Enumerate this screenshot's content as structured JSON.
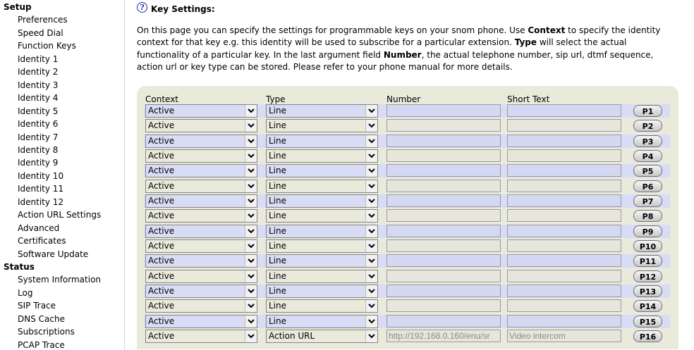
{
  "sidebar": {
    "setup_heading": "Setup",
    "setup_items": [
      "Preferences",
      "Speed Dial",
      "Function Keys",
      "Identity 1",
      "Identity 2",
      "Identity 3",
      "Identity 4",
      "Identity 5",
      "Identity 6",
      "Identity 7",
      "Identity 8",
      "Identity 9",
      "Identity 10",
      "Identity 11",
      "Identity 12",
      "Action URL Settings",
      "Advanced",
      "Certificates",
      "Software Update"
    ],
    "status_heading": "Status",
    "status_items": [
      "System Information",
      "Log",
      "SIP Trace",
      "DNS Cache",
      "Subscriptions",
      "PCAP Trace"
    ]
  },
  "page": {
    "title": "Key Settings:",
    "help_icon": "help-icon",
    "intro": [
      {
        "t": "On this page you can specify the settings for programmable keys on your snom phone. Use ",
        "b": false
      },
      {
        "t": "Context",
        "b": true
      },
      {
        "t": " to specify the identity context for that key e.g. this identity will be used to subscribe for a particular extension. ",
        "b": false
      },
      {
        "t": "Type",
        "b": true
      },
      {
        "t": " will select the actual functionality of a particular key. In the last argument field ",
        "b": false
      },
      {
        "t": "Number",
        "b": true
      },
      {
        "t": ", the actual telephone number, sip url, dtmf sequence, action url or key type can be stored. Please refer to your phone manual for more details.",
        "b": false
      }
    ]
  },
  "table": {
    "headers": {
      "context": "Context",
      "type": "Type",
      "number": "Number",
      "short_text": "Short Text"
    },
    "rows": [
      {
        "context": "Active",
        "type": "Line",
        "number": "",
        "short_text": "",
        "key": "P1"
      },
      {
        "context": "Active",
        "type": "Line",
        "number": "",
        "short_text": "",
        "key": "P2"
      },
      {
        "context": "Active",
        "type": "Line",
        "number": "",
        "short_text": "",
        "key": "P3"
      },
      {
        "context": "Active",
        "type": "Line",
        "number": "",
        "short_text": "",
        "key": "P4"
      },
      {
        "context": "Active",
        "type": "Line",
        "number": "",
        "short_text": "",
        "key": "P5"
      },
      {
        "context": "Active",
        "type": "Line",
        "number": "",
        "short_text": "",
        "key": "P6"
      },
      {
        "context": "Active",
        "type": "Line",
        "number": "",
        "short_text": "",
        "key": "P7"
      },
      {
        "context": "Active",
        "type": "Line",
        "number": "",
        "short_text": "",
        "key": "P8"
      },
      {
        "context": "Active",
        "type": "Line",
        "number": "",
        "short_text": "",
        "key": "P9"
      },
      {
        "context": "Active",
        "type": "Line",
        "number": "",
        "short_text": "",
        "key": "P10"
      },
      {
        "context": "Active",
        "type": "Line",
        "number": "",
        "short_text": "",
        "key": "P11"
      },
      {
        "context": "Active",
        "type": "Line",
        "number": "",
        "short_text": "",
        "key": "P12"
      },
      {
        "context": "Active",
        "type": "Line",
        "number": "",
        "short_text": "",
        "key": "P13"
      },
      {
        "context": "Active",
        "type": "Line",
        "number": "",
        "short_text": "",
        "key": "P14"
      },
      {
        "context": "Active",
        "type": "Line",
        "number": "",
        "short_text": "",
        "key": "P15"
      },
      {
        "context": "Active",
        "type": "Action URL",
        "number": "http://192.168.0.160/enu/sr",
        "short_text": "Video intercom",
        "key": "P16"
      }
    ]
  },
  "colors": {
    "panel_bg": "#eaeadc",
    "row_alt": "#d8dcf4",
    "help_blue": "#1a2d9c"
  }
}
